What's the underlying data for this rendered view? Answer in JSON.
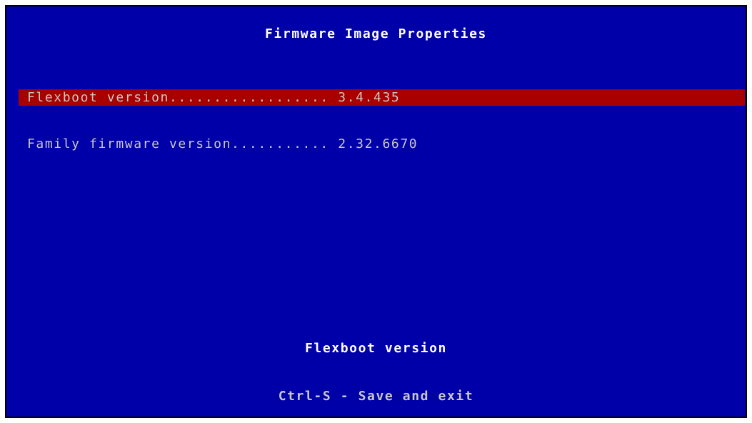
{
  "title": "Firmware Image Properties",
  "colors": {
    "background": "#0000a8",
    "highlight": "#a80000",
    "text": "#c8c8c8",
    "title": "#ffffff"
  },
  "menu": {
    "items": [
      {
        "label": "Flexboot version.................. 3.4.435",
        "selected": true
      },
      {
        "label": "Family firmware version........... 2.32.6670",
        "selected": false
      }
    ]
  },
  "help_text": "Flexboot version",
  "footer": "Ctrl-S - Save and exit"
}
